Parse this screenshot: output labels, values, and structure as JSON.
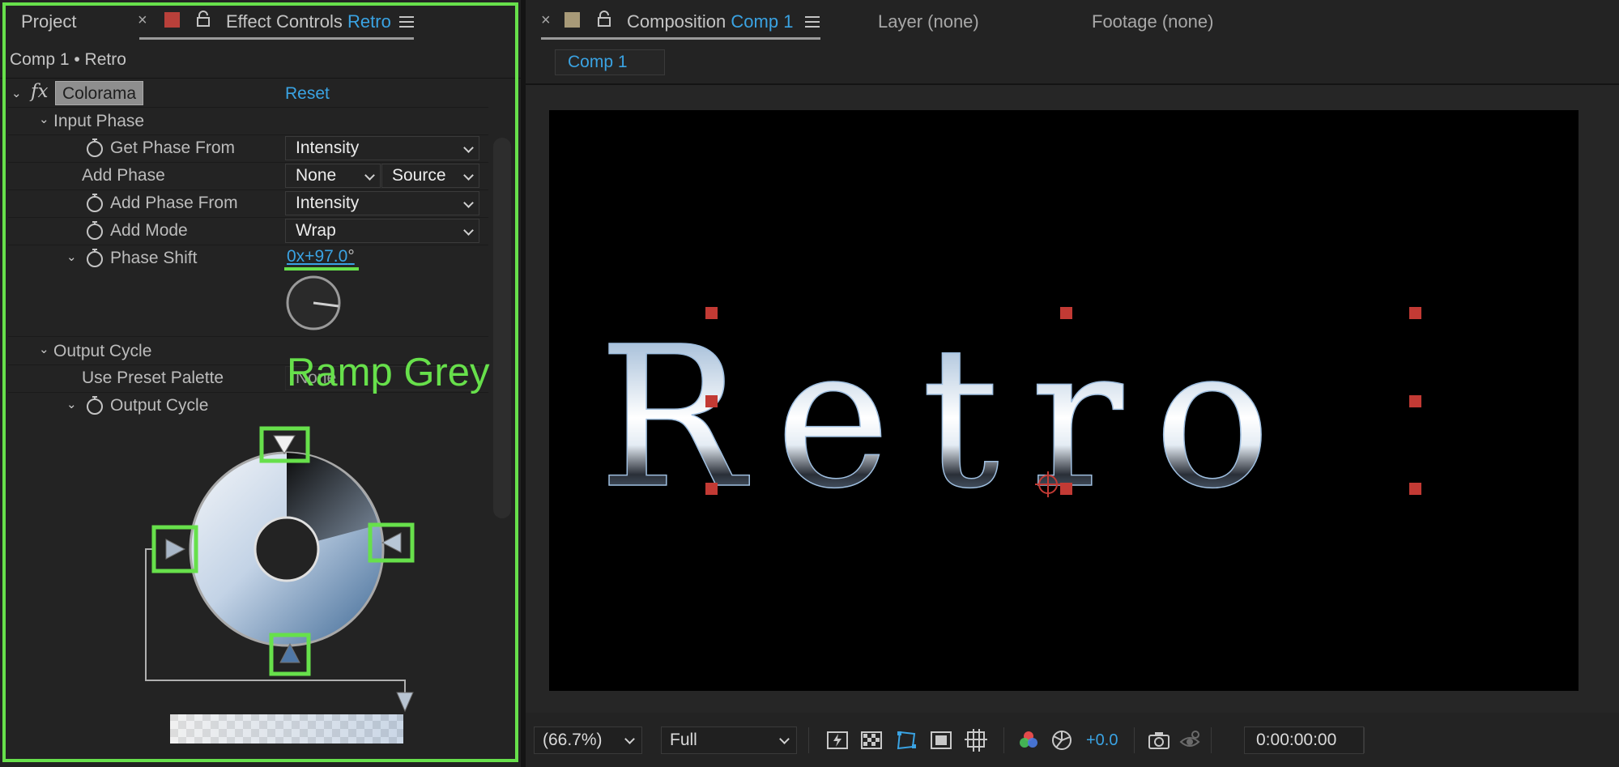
{
  "left_panel": {
    "tabs": {
      "project": "Project",
      "effect_controls_prefix": "Effect Controls",
      "effect_controls_layer": "Retro"
    },
    "breadcrumb": "Comp 1 • Retro",
    "effect": {
      "fx": "fx",
      "name": "Colorama",
      "reset": "Reset"
    },
    "input_phase": {
      "group_label": "Input Phase",
      "get_phase_from": {
        "label": "Get Phase From",
        "value": "Intensity"
      },
      "add_phase": {
        "label": "Add Phase",
        "value": "None",
        "source": "Source"
      },
      "add_phase_from": {
        "label": "Add Phase From",
        "value": "Intensity"
      },
      "add_mode": {
        "label": "Add Mode",
        "value": "Wrap"
      },
      "phase_shift": {
        "label": "Phase Shift",
        "value": "0x+97.0",
        "unit": "°"
      }
    },
    "output_cycle": {
      "group_label": "Output Cycle",
      "use_preset_palette": {
        "label": "Use Preset Palette",
        "value": "None"
      },
      "output_cycle_label": "Output Cycle"
    },
    "annotation": "Ramp Grey"
  },
  "right_panel": {
    "tabs": {
      "composition_prefix": "Composition",
      "composition_name": "Comp 1",
      "layer": "Layer (none)",
      "footage": "Footage (none)"
    },
    "comp_chip": "Comp 1",
    "canvas_text": "Retro",
    "footer": {
      "zoom": "(66.7%)",
      "resolution": "Full",
      "exposure": "+0.0",
      "timecode": "0:00:00:00"
    }
  },
  "colors": {
    "accent_blue": "#3aa3e3",
    "highlight_green": "#67e04b",
    "label_red": "#b8403a",
    "label_tan": "#a89a78"
  }
}
